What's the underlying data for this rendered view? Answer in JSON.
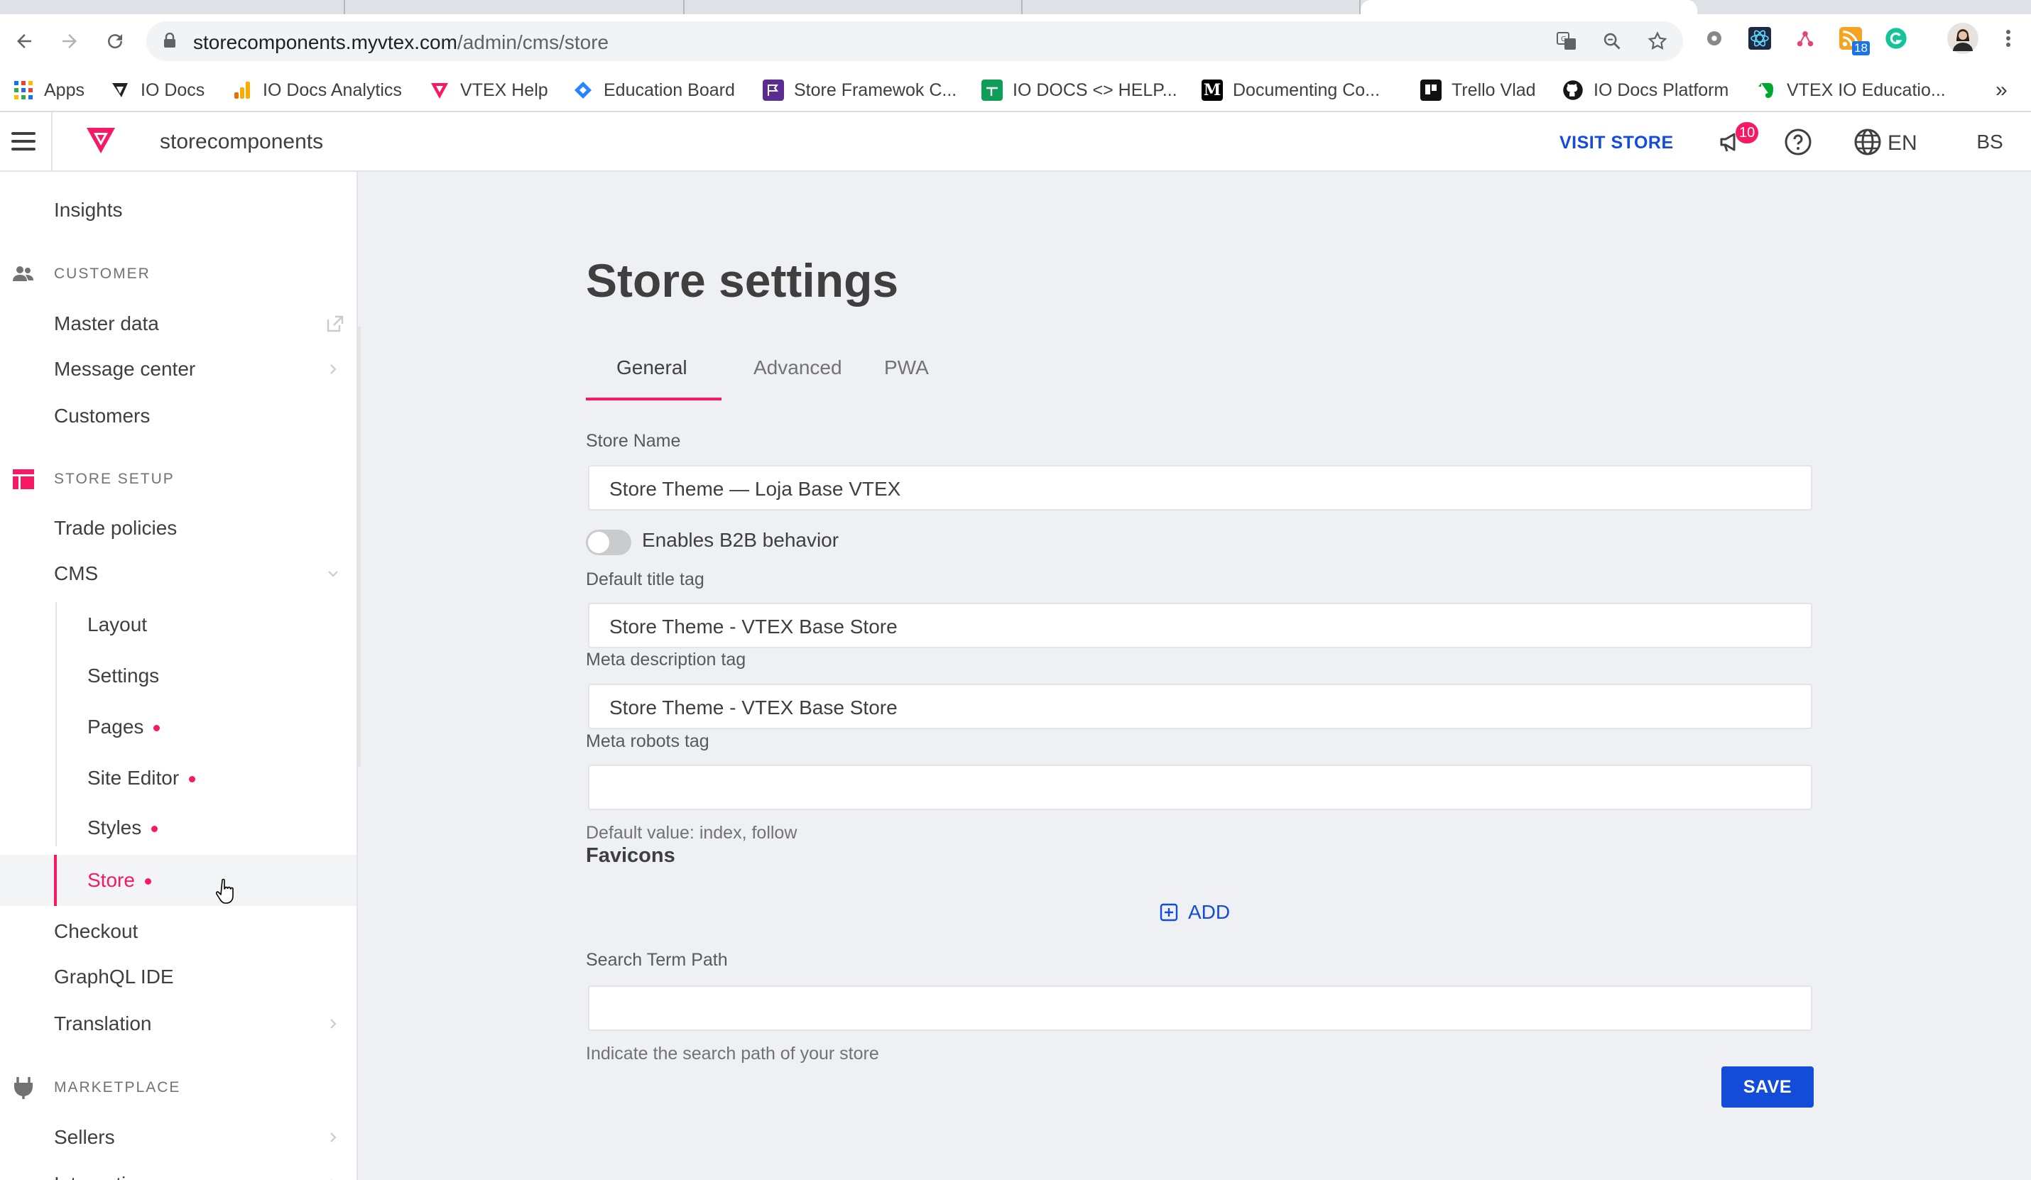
{
  "browser": {
    "url_host": "storecomponents.myvtex.com",
    "url_path": "/admin/cms/store",
    "extension_badge": "18",
    "bookmarks": [
      {
        "label": "Apps"
      },
      {
        "label": "IO Docs"
      },
      {
        "label": "IO Docs Analytics"
      },
      {
        "label": "VTEX Help"
      },
      {
        "label": "Education Board"
      },
      {
        "label": "Store Framewok C..."
      },
      {
        "label": "IO DOCS <> HELP..."
      },
      {
        "label": "Documenting Co..."
      },
      {
        "label": "Trello Vlad"
      },
      {
        "label": "IO Docs Platform"
      },
      {
        "label": "VTEX IO Educatio..."
      }
    ],
    "overflow": "»"
  },
  "header": {
    "store_name": "storecomponents",
    "visit_store": "VISIT STORE",
    "notifications_count": "10",
    "language": "EN",
    "avatar_initials": "BS"
  },
  "sidebar": {
    "insights": "Insights",
    "customer_section": "CUSTOMER",
    "master_data": "Master data",
    "message_center": "Message center",
    "customers": "Customers",
    "store_setup_section": "STORE SETUP",
    "trade_policies": "Trade policies",
    "cms": "CMS",
    "layout": "Layout",
    "settings": "Settings",
    "pages": "Pages",
    "site_editor": "Site Editor",
    "styles": "Styles",
    "store": "Store",
    "checkout": "Checkout",
    "graphql_ide": "GraphQL IDE",
    "translation": "Translation",
    "marketplace_section": "MARKETPLACE",
    "sellers": "Sellers",
    "integrations": "Integrations"
  },
  "main": {
    "title": "Store settings",
    "tabs": [
      {
        "label": "General",
        "active": true
      },
      {
        "label": "Advanced",
        "active": false
      },
      {
        "label": "PWA",
        "active": false
      }
    ],
    "store_name_label": "Store Name",
    "store_name_value": "Store Theme — Loja Base VTEX",
    "b2b_toggle_label": "Enables B2B behavior",
    "b2b_enabled": false,
    "title_tag_label": "Default title tag",
    "title_tag_value": "Store Theme - VTEX Base Store",
    "meta_description_label": "Meta description tag",
    "meta_description_value": "Store Theme - VTEX Base Store",
    "meta_robots_label": "Meta robots tag",
    "meta_robots_value": "",
    "meta_robots_helper": "Default value: index, follow",
    "favicons_heading": "Favicons",
    "add_label": "ADD",
    "search_term_label": "Search Term Path",
    "search_term_value": "",
    "search_term_helper": "Indicate the search path of your store",
    "save_label": "SAVE"
  },
  "colors": {
    "accent": "#f71963",
    "primary": "#134cd8"
  }
}
